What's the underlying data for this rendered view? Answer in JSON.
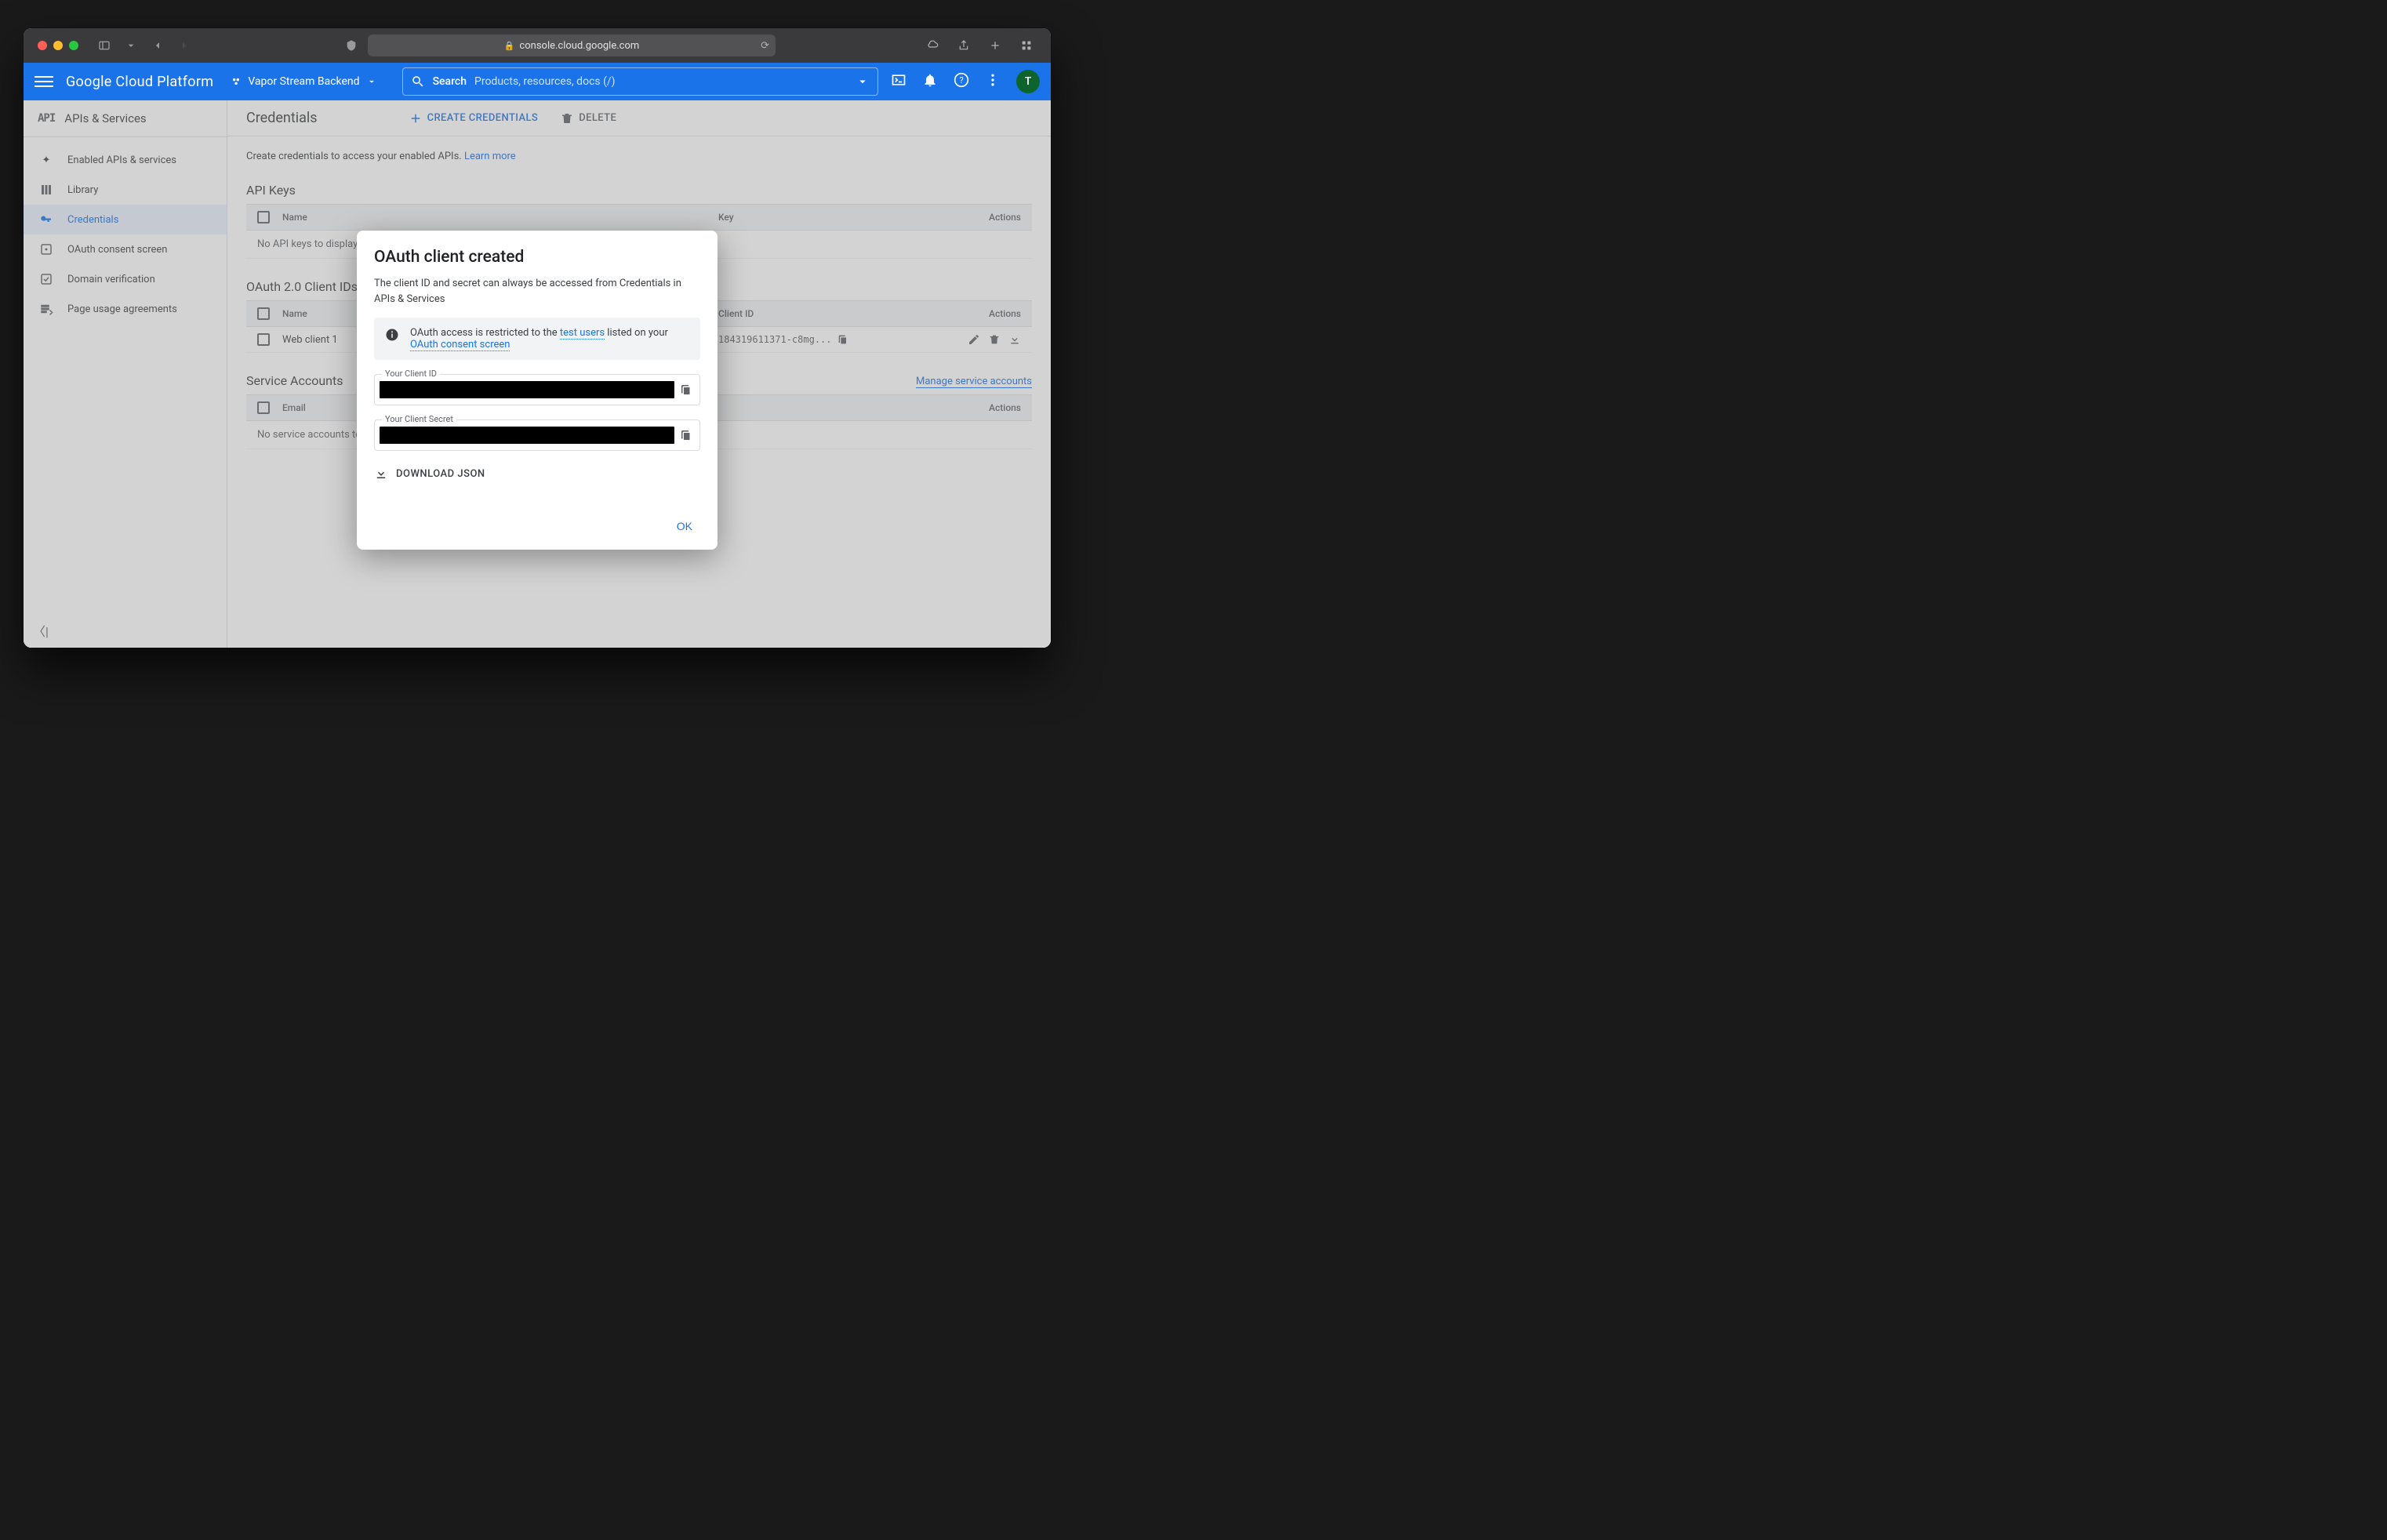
{
  "browser": {
    "url": "console.cloud.google.com"
  },
  "gcp": {
    "platform": "Google Cloud Platform",
    "project": "Vapor Stream Backend",
    "search_label": "Search",
    "search_placeholder": "Products, resources, docs (/)",
    "avatar_letter": "T"
  },
  "sidebar": {
    "badge": "API",
    "title": "APIs & Services",
    "items": [
      {
        "label": "Enabled APIs & services"
      },
      {
        "label": "Library"
      },
      {
        "label": "Credentials"
      },
      {
        "label": "OAuth consent screen"
      },
      {
        "label": "Domain verification"
      },
      {
        "label": "Page usage agreements"
      }
    ]
  },
  "page": {
    "title": "Credentials",
    "create_btn": "CREATE CREDENTIALS",
    "delete_btn": "DELETE",
    "intro_text": "Create credentials to access your enabled APIs. ",
    "intro_link": "Learn more"
  },
  "sections": {
    "api_keys": {
      "title": "API Keys",
      "cols": {
        "name": "Name",
        "key": "Key",
        "actions": "Actions"
      },
      "empty": "No API keys to display"
    },
    "oauth_clients": {
      "title": "OAuth 2.0 Client IDs",
      "cols": {
        "name": "Name",
        "cid": "Client ID",
        "actions": "Actions"
      },
      "rows": [
        {
          "name": "Web client 1",
          "client_id": "184319611371-c8mg..."
        }
      ]
    },
    "service_accounts": {
      "title": "Service Accounts",
      "manage_link": "Manage service accounts",
      "cols": {
        "email": "Email",
        "actions": "Actions"
      },
      "empty_prefix": "No service accounts to dis"
    }
  },
  "modal": {
    "title": "OAuth client created",
    "desc": "The client ID and secret can always be accessed from Credentials in APIs & Services",
    "info_pre": "OAuth access is restricted to the ",
    "info_link1": "test users",
    "info_mid": " listed on your ",
    "info_link2": "OAuth consent screen",
    "client_id_label": "Your Client ID",
    "client_secret_label": "Your Client Secret",
    "download": "DOWNLOAD JSON",
    "ok": "OK"
  }
}
